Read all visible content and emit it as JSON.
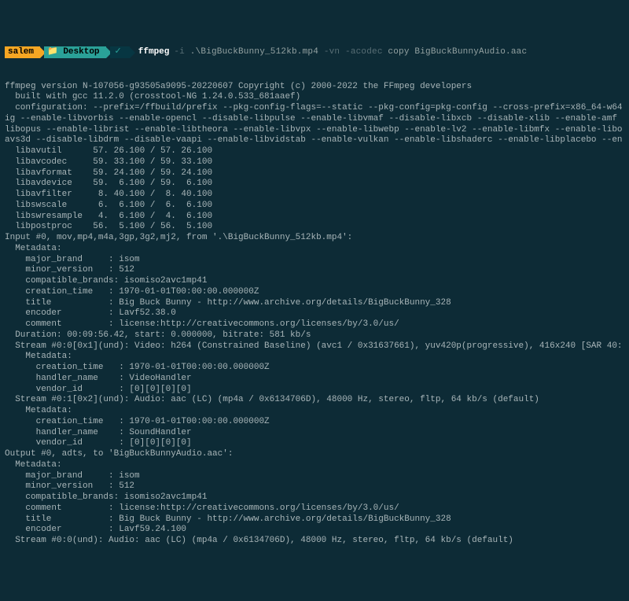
{
  "prompt": {
    "user": "salem",
    "desktop": "Desktop",
    "check": "✓",
    "cmd_name": "ffmpeg",
    "cmd_args_dim1": "-i",
    "cmd_args_file": " .\\BigBuckBunny_512kb.mp4 ",
    "cmd_args_dim2": "-vn -acodec",
    "cmd_args_rest": " copy BigBuckBunnyAudio.aac"
  },
  "lines": [
    "ffmpeg version N-107056-g93505a9095-20220607 Copyright (c) 2000-2022 the FFmpeg developers",
    "  built with gcc 11.2.0 (crosstool-NG 1.24.0.533_681aaef)",
    "  configuration: --prefix=/ffbuild/prefix --pkg-config-flags=--static --pkg-config=pkg-config --cross-prefix=x86_64-w64",
    "ig --enable-libvorbis --enable-opencl --disable-libpulse --enable-libvmaf --disable-libxcb --disable-xlib --enable-amf",
    "libopus --enable-librist --enable-libtheora --enable-libvpx --enable-libwebp --enable-lv2 --enable-libmfx --enable-libo",
    "avs3d --disable-libdrm --disable-vaapi --enable-libvidstab --enable-vulkan --enable-libshaderc --enable-libplacebo --en",
    "  libavutil      57. 26.100 / 57. 26.100",
    "  libavcodec     59. 33.100 / 59. 33.100",
    "  libavformat    59. 24.100 / 59. 24.100",
    "  libavdevice    59.  6.100 / 59.  6.100",
    "  libavfilter     8. 40.100 /  8. 40.100",
    "  libswscale      6.  6.100 /  6.  6.100",
    "  libswresample   4.  6.100 /  4.  6.100",
    "  libpostproc    56.  5.100 / 56.  5.100",
    "Input #0, mov,mp4,m4a,3gp,3g2,mj2, from '.\\BigBuckBunny_512kb.mp4':",
    "  Metadata:",
    "    major_brand     : isom",
    "    minor_version   : 512",
    "    compatible_brands: isomiso2avc1mp41",
    "    creation_time   : 1970-01-01T00:00:00.000000Z",
    "    title           : Big Buck Bunny - http://www.archive.org/details/BigBuckBunny_328",
    "    encoder         : Lavf52.38.0",
    "    comment         : license:http://creativecommons.org/licenses/by/3.0/us/",
    "  Duration: 00:09:56.42, start: 0.000000, bitrate: 581 kb/s",
    "  Stream #0:0[0x1](und): Video: h264 (Constrained Baseline) (avc1 / 0x31637661), yuv420p(progressive), 416x240 [SAR 40:",
    "    Metadata:",
    "      creation_time   : 1970-01-01T00:00:00.000000Z",
    "      handler_name    : VideoHandler",
    "      vendor_id       : [0][0][0][0]",
    "  Stream #0:1[0x2](und): Audio: aac (LC) (mp4a / 0x6134706D), 48000 Hz, stereo, fltp, 64 kb/s (default)",
    "    Metadata:",
    "      creation_time   : 1970-01-01T00:00:00.000000Z",
    "      handler_name    : SoundHandler",
    "      vendor_id       : [0][0][0][0]",
    "Output #0, adts, to 'BigBuckBunnyAudio.aac':",
    "  Metadata:",
    "    major_brand     : isom",
    "    minor_version   : 512",
    "    compatible_brands: isomiso2avc1mp41",
    "    comment         : license:http://creativecommons.org/licenses/by/3.0/us/",
    "    title           : Big Buck Bunny - http://www.archive.org/details/BigBuckBunny_328",
    "    encoder         : Lavf59.24.100",
    "  Stream #0:0(und): Audio: aac (LC) (mp4a / 0x6134706D), 48000 Hz, stereo, fltp, 64 kb/s (default)"
  ]
}
